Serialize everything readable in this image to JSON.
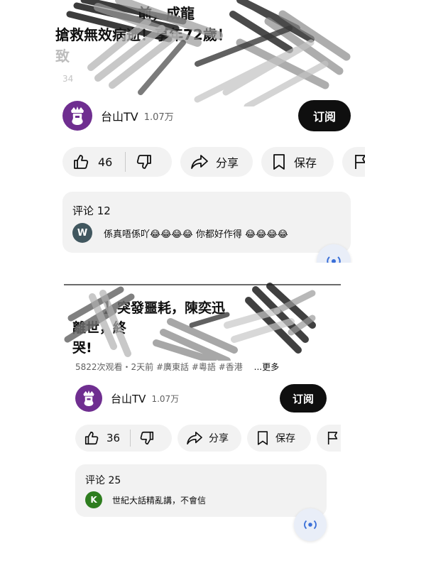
{
  "cards": [
    {
      "title_line1": "前，成龍",
      "title_line2": "搶救無效病逝！享年72歲！",
      "title_line3": "致",
      "meta": "34",
      "channel": {
        "name": "台山TV",
        "subscribers": "1.07万"
      },
      "subscribe_label": "订阅",
      "actions": {
        "likes": "46",
        "share": "分享",
        "save": "保存"
      },
      "comments": {
        "header": "评论 12",
        "avatar_letter": "W",
        "avatar_color": "#41575f",
        "text": "係真唔係吖😂😂😂😂 你都好作得 😂😂😂😂"
      }
    },
    {
      "title_line1": "】突發噩耗，陳奕迅",
      "title_line2": "離世，終",
      "title_line3": "哭!",
      "meta": "5822次观看・2天前  #廣東話 #粵語 #香港",
      "more": "...更多",
      "channel": {
        "name": "台山TV",
        "subscribers": "1.07万"
      },
      "subscribe_label": "订阅",
      "actions": {
        "likes": "36",
        "share": "分享",
        "save": "保存"
      },
      "comments": {
        "header": "评论 25",
        "avatar_letter": "K",
        "avatar_color": "#2e7d1f",
        "text": "世紀大話精亂講，不會信"
      }
    }
  ],
  "colors": {
    "brand_avatar": "#6f2e90",
    "subscribe_bg": "#0f0f0f",
    "pill_bg": "#f2f2f2"
  },
  "icons": [
    "crown-avatar-icon",
    "thumbs-up-icon",
    "thumbs-down-icon",
    "share-arrow-icon",
    "bookmark-icon",
    "flag-icon",
    "floating-action-icon"
  ]
}
